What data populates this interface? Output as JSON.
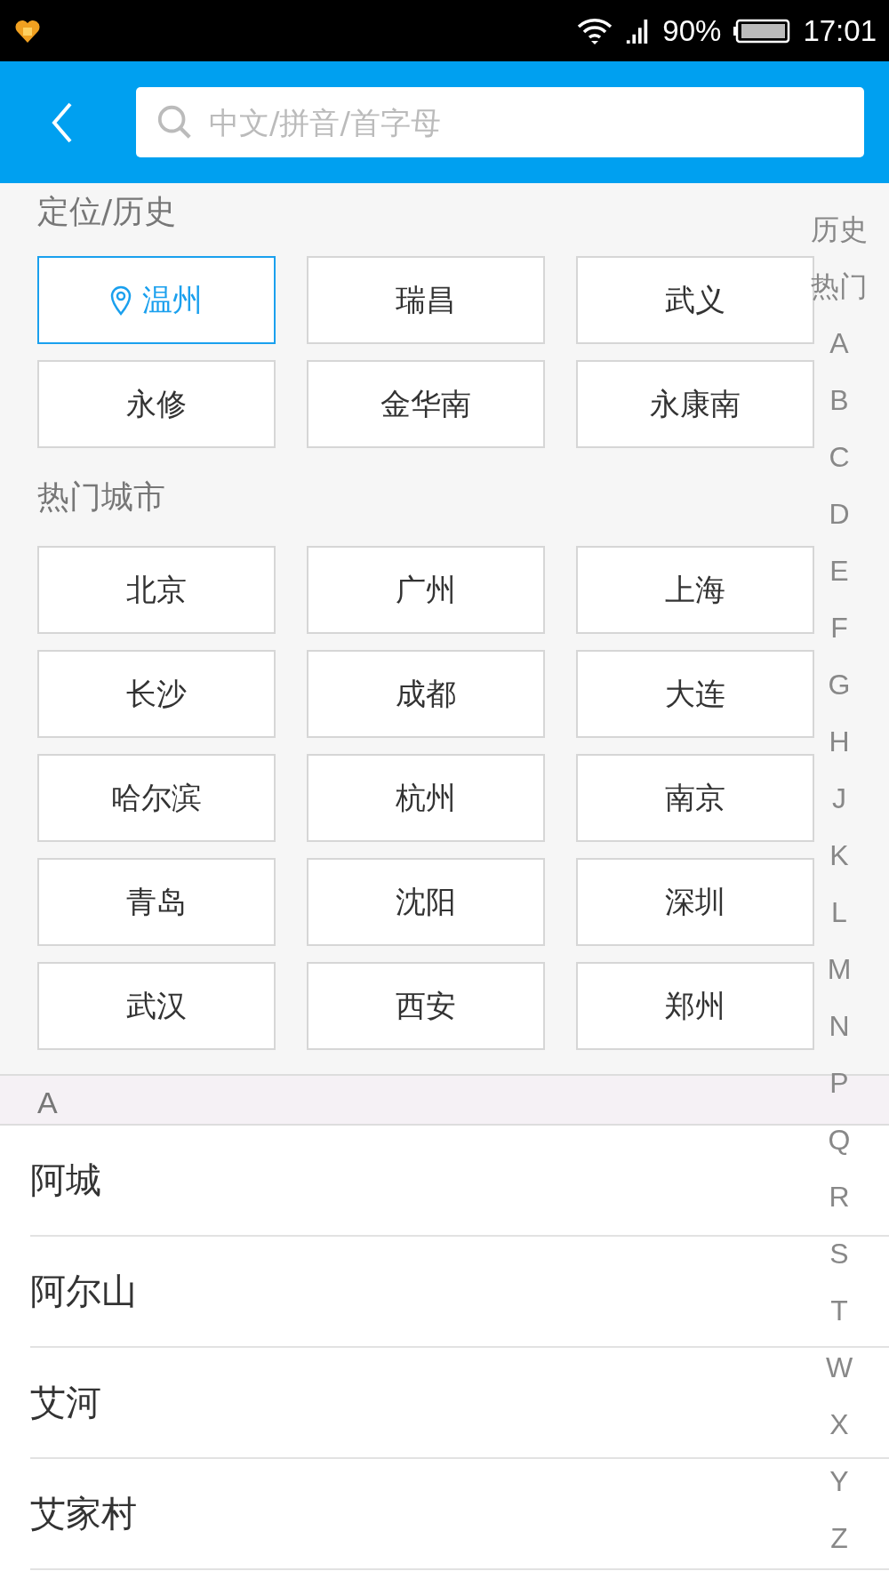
{
  "status_bar": {
    "battery_percent": "90%",
    "time": "17:01"
  },
  "header": {
    "search": {
      "placeholder": "中文/拼音/首字母"
    }
  },
  "history": {
    "title": "定位/历史",
    "items": [
      {
        "label": "温州",
        "kind": "location",
        "selected": true
      },
      {
        "label": "瑞昌",
        "kind": "city",
        "selected": false
      },
      {
        "label": "武义",
        "kind": "city",
        "selected": false
      },
      {
        "label": "永修",
        "kind": "city",
        "selected": false
      },
      {
        "label": "金华南",
        "kind": "city",
        "selected": false
      },
      {
        "label": "永康南",
        "kind": "city",
        "selected": false
      }
    ]
  },
  "hot_cities": {
    "title": "热门城市",
    "items": [
      "北京",
      "广州",
      "上海",
      "长沙",
      "成都",
      "大连",
      "哈尔滨",
      "杭州",
      "南京",
      "青岛",
      "沈阳",
      "深圳",
      "武汉",
      "西安",
      "郑州"
    ]
  },
  "city_list": {
    "header": "A",
    "items": [
      "阿城",
      "阿尔山",
      "艾河",
      "艾家村"
    ]
  },
  "index_bar": [
    "历史",
    "热门",
    "A",
    "B",
    "C",
    "D",
    "E",
    "F",
    "G",
    "H",
    "J",
    "K",
    "L",
    "M",
    "N",
    "P",
    "Q",
    "R",
    "S",
    "T",
    "W",
    "X",
    "Y",
    "Z"
  ]
}
